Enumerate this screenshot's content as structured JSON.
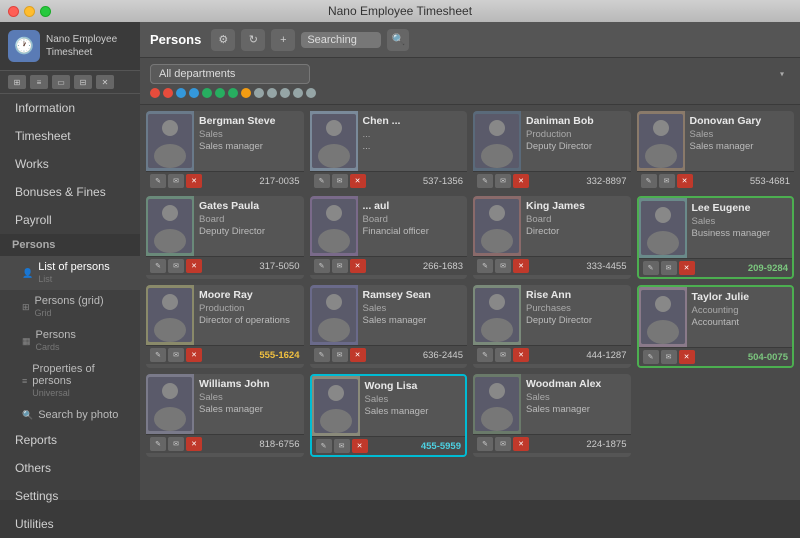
{
  "window": {
    "title": "Nano Employee Timesheet"
  },
  "sidebar": {
    "logo_text": "Nano Employee\nTimesheet",
    "nav_items": [
      {
        "id": "information",
        "label": "Information",
        "active": false
      },
      {
        "id": "timesheet",
        "label": "Timesheet",
        "active": false
      },
      {
        "id": "works",
        "label": "Works",
        "active": false
      },
      {
        "id": "bonuses",
        "label": "Bonuses & Fines",
        "active": false
      },
      {
        "id": "payroll",
        "label": "Payroll",
        "active": false
      },
      {
        "id": "persons",
        "label": "Persons",
        "active": true,
        "section": true
      }
    ],
    "sub_items": [
      {
        "id": "list-persons",
        "label": "List of persons",
        "sub": "List",
        "icon": "👤"
      },
      {
        "id": "persons-grid",
        "label": "Persons (grid)",
        "sub": "Grid",
        "icon": "⊞"
      },
      {
        "id": "persons-cards",
        "label": "Persons",
        "sub": "Cards",
        "icon": "▦"
      },
      {
        "id": "properties",
        "label": "Properties of persons",
        "sub": "Universal",
        "icon": "≡"
      },
      {
        "id": "search-photo",
        "label": "Search by photo",
        "sub": "",
        "icon": "🔍"
      }
    ],
    "bottom_items": [
      {
        "id": "reports",
        "label": "Reports"
      },
      {
        "id": "others",
        "label": "Others"
      },
      {
        "id": "settings",
        "label": "Settings"
      },
      {
        "id": "utilities",
        "label": "Utilities"
      }
    ]
  },
  "toolbar": {
    "title": "Persons",
    "search_placeholder": "Searching"
  },
  "filter": {
    "department": "All departments",
    "dots": [
      "#e74c3c",
      "#e74c3c",
      "#3498db",
      "#3498db",
      "#27ae60",
      "#27ae60",
      "#27ae60",
      "#f39c12",
      "#95a5a6",
      "#95a5a6",
      "#95a5a6",
      "#95a5a6",
      "#95a5a6"
    ]
  },
  "persons": [
    {
      "name": "Bergman Steve",
      "dept": "Sales",
      "role": "Sales manager",
      "phone": "217-0035",
      "phone_color": "normal",
      "highlight": false
    },
    {
      "name": "Chen ...",
      "dept": "...",
      "role": "...",
      "phone": "537-1356",
      "phone_color": "normal",
      "highlight": false,
      "featured": true
    },
    {
      "name": "Daniman Bob",
      "dept": "Production",
      "role": "Deputy Director",
      "phone": "332-8897",
      "phone_color": "normal",
      "highlight": false
    },
    {
      "name": "Donovan Gary",
      "dept": "Sales",
      "role": "Sales manager",
      "phone": "553-4681",
      "phone_color": "normal",
      "highlight": false
    },
    {
      "name": "Gates Paula",
      "dept": "Board",
      "role": "Deputy Director",
      "phone": "317-5050",
      "phone_color": "normal",
      "highlight": false
    },
    {
      "name": "... aul",
      "dept": "Board",
      "role": "Financial officer",
      "phone": "266-1683",
      "phone_color": "normal",
      "highlight": false
    },
    {
      "name": "King James",
      "dept": "Board",
      "role": "Director",
      "phone": "333-4455",
      "phone_color": "normal",
      "highlight": false
    },
    {
      "name": "Lee Eugene",
      "dept": "Sales",
      "role": "Business manager",
      "phone": "209-9284",
      "phone_color": "green",
      "highlight": true
    },
    {
      "name": "Moore Ray",
      "dept": "Production",
      "role": "Director of operations",
      "phone": "555-1624",
      "phone_color": "yellow",
      "highlight": false
    },
    {
      "name": "Ramsey Sean",
      "dept": "Sales",
      "role": "Sales manager",
      "phone": "636-2445",
      "phone_color": "normal",
      "highlight": false
    },
    {
      "name": "Rise Ann",
      "dept": "Purchases",
      "role": "Deputy Director",
      "phone": "444-1287",
      "phone_color": "normal",
      "highlight": false
    },
    {
      "name": "Taylor Julie",
      "dept": "Accounting",
      "role": "Accountant",
      "phone": "504-0075",
      "phone_color": "green",
      "highlight": true
    },
    {
      "name": "Williams John",
      "dept": "Sales",
      "role": "Sales manager",
      "phone": "818-6756",
      "phone_color": "normal",
      "highlight": false
    },
    {
      "name": "Wong Lisa",
      "dept": "Sales",
      "role": "Sales manager",
      "phone": "455-5959",
      "phone_color": "cyan",
      "highlight": false,
      "highlight_cyan": true
    },
    {
      "name": "Woodman Alex",
      "dept": "Sales",
      "role": "Sales manager",
      "phone": "224-1875",
      "phone_color": "normal",
      "highlight": false
    }
  ],
  "icons": {
    "filter": "⚙",
    "refresh": "↻",
    "add": "+",
    "search": "🔍",
    "edit": "✎",
    "email": "✉",
    "delete": "✕",
    "person": "👤",
    "grid": "⊞",
    "list": "≡",
    "chevron_down": "▾"
  }
}
